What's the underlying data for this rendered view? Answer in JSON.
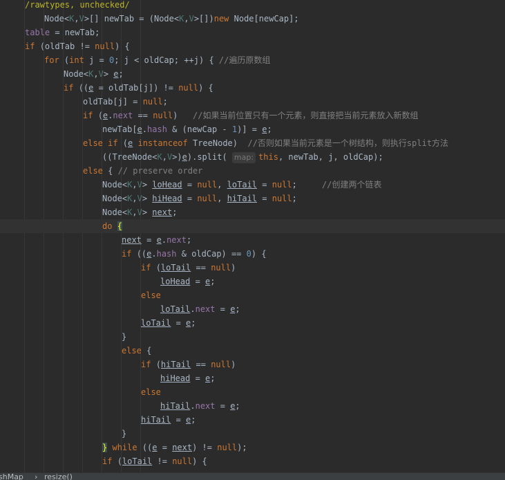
{
  "editor": {
    "lines": [
      [
        [
          "ann",
          "/rawtypes, unchecked/"
        ]
      ],
      [
        [
          "",
          "Node<"
        ],
        [
          "tp",
          "K"
        ],
        [
          "",
          ","
        ],
        [
          "tp",
          "V"
        ],
        [
          "",
          ">[] newTab = (Node<"
        ],
        [
          "tp",
          "K"
        ],
        [
          "",
          ","
        ],
        [
          "tp",
          "V"
        ],
        [
          "",
          ">[])"
        ],
        [
          "kw",
          "new "
        ],
        [
          "",
          "Node[newCap];"
        ]
      ],
      [
        [
          "fld",
          "table"
        ],
        [
          "",
          " = newTab;"
        ]
      ],
      [
        [
          "kw",
          "if "
        ],
        [
          "",
          "(oldTab != "
        ],
        [
          "kw",
          "null"
        ],
        [
          "",
          ") {"
        ]
      ],
      [
        [
          "kw",
          "for "
        ],
        [
          "",
          "("
        ],
        [
          "kw",
          "int "
        ],
        [
          "",
          "j = "
        ],
        [
          "num",
          "0"
        ],
        [
          "",
          "; j < oldCap; ++j) { "
        ],
        [
          "cmt",
          "//遍历原数组"
        ]
      ],
      [
        [
          "",
          "Node<"
        ],
        [
          "tp",
          "K"
        ],
        [
          "",
          ","
        ],
        [
          "tp",
          "V"
        ],
        [
          "",
          "> "
        ],
        [
          "ul",
          "e"
        ],
        [
          "",
          ";"
        ]
      ],
      [
        [
          "kw",
          "if "
        ],
        [
          "",
          "(("
        ],
        [
          "ul",
          "e"
        ],
        [
          "",
          " = oldTab[j]) != "
        ],
        [
          "kw",
          "null"
        ],
        [
          "",
          ") {"
        ]
      ],
      [
        [
          "",
          "oldTab[j] = "
        ],
        [
          "kw",
          "null"
        ],
        [
          "",
          ";"
        ]
      ],
      [
        [
          "kw",
          "if "
        ],
        [
          "",
          "("
        ],
        [
          "ul",
          "e"
        ],
        [
          "",
          "."
        ],
        [
          "fld",
          "next"
        ],
        [
          "",
          " == "
        ],
        [
          "kw",
          "null"
        ],
        [
          "",
          ")   "
        ],
        [
          "cmt",
          "//如果当前位置只有一个元素，则直接把当前元素放入新数组"
        ]
      ],
      [
        [
          "",
          "newTab["
        ],
        [
          "ul",
          "e"
        ],
        [
          "",
          "."
        ],
        [
          "fld",
          "hash"
        ],
        [
          "",
          " & (newCap - "
        ],
        [
          "num",
          "1"
        ],
        [
          "",
          ")] = "
        ],
        [
          "ul",
          "e"
        ],
        [
          "",
          ";"
        ]
      ],
      [
        [
          "kw",
          "else if "
        ],
        [
          "",
          "("
        ],
        [
          "ul",
          "e"
        ],
        [
          "",
          " "
        ],
        [
          "kw",
          "instanceof "
        ],
        [
          "",
          "TreeNode)  "
        ],
        [
          "cmt",
          "//否则如果当前元素是一个树结构，则执行split方法"
        ]
      ],
      [
        [
          "",
          "((TreeNode<"
        ],
        [
          "tp",
          "K"
        ],
        [
          "",
          ","
        ],
        [
          "tp",
          "V"
        ],
        [
          "",
          ">)"
        ],
        [
          "ul",
          "e"
        ],
        [
          "",
          ").split( "
        ],
        [
          "hint",
          "map:"
        ],
        [
          "kw",
          "this"
        ],
        [
          "",
          ", newTab, j, oldCap);"
        ]
      ],
      [
        [
          "kw",
          "else "
        ],
        [
          "",
          "{ "
        ],
        [
          "cmt",
          "// preserve order"
        ]
      ],
      [
        [
          "",
          "Node<"
        ],
        [
          "tp",
          "K"
        ],
        [
          "",
          ","
        ],
        [
          "tp",
          "V"
        ],
        [
          "",
          "> "
        ],
        [
          "ul",
          "loHead"
        ],
        [
          "",
          " = "
        ],
        [
          "kw",
          "null"
        ],
        [
          "",
          ", "
        ],
        [
          "ul",
          "loTail"
        ],
        [
          "",
          " = "
        ],
        [
          "kw",
          "null"
        ],
        [
          "",
          ";     "
        ],
        [
          "cmt",
          "//创建两个链表"
        ]
      ],
      [
        [
          "",
          "Node<"
        ],
        [
          "tp",
          "K"
        ],
        [
          "",
          ","
        ],
        [
          "tp",
          "V"
        ],
        [
          "",
          "> "
        ],
        [
          "ul",
          "hiHead"
        ],
        [
          "",
          " = "
        ],
        [
          "kw",
          "null"
        ],
        [
          "",
          ", "
        ],
        [
          "ul",
          "hiTail"
        ],
        [
          "",
          " = "
        ],
        [
          "kw",
          "null"
        ],
        [
          "",
          ";"
        ]
      ],
      [
        [
          "",
          "Node<"
        ],
        [
          "tp",
          "K"
        ],
        [
          "",
          ","
        ],
        [
          "tp",
          "V"
        ],
        [
          "",
          "> "
        ],
        [
          "ul",
          "next"
        ],
        [
          "",
          ";"
        ]
      ],
      [
        [
          "kw",
          "do "
        ],
        [
          "brace",
          "{"
        ]
      ],
      [
        [
          "ul",
          "next"
        ],
        [
          "",
          " = "
        ],
        [
          "ul",
          "e"
        ],
        [
          "",
          "."
        ],
        [
          "fld",
          "next"
        ],
        [
          "",
          ";"
        ]
      ],
      [
        [
          "kw",
          "if "
        ],
        [
          "",
          "(("
        ],
        [
          "ul",
          "e"
        ],
        [
          "",
          "."
        ],
        [
          "fld",
          "hash"
        ],
        [
          "",
          " & oldCap) == "
        ],
        [
          "num",
          "0"
        ],
        [
          "",
          ") {"
        ]
      ],
      [
        [
          "kw",
          "if "
        ],
        [
          "",
          "("
        ],
        [
          "ul",
          "loTail"
        ],
        [
          "",
          " == "
        ],
        [
          "kw",
          "null"
        ],
        [
          "",
          ")"
        ]
      ],
      [
        [
          "ul",
          "loHead"
        ],
        [
          "",
          " = "
        ],
        [
          "ul",
          "e"
        ],
        [
          "",
          ";"
        ]
      ],
      [
        [
          "kw",
          "else"
        ]
      ],
      [
        [
          "ul",
          "loTail"
        ],
        [
          "",
          "."
        ],
        [
          "fld",
          "next"
        ],
        [
          "",
          " = "
        ],
        [
          "ul",
          "e"
        ],
        [
          "",
          ";"
        ]
      ],
      [
        [
          "ul",
          "loTail"
        ],
        [
          "",
          " = "
        ],
        [
          "ul",
          "e"
        ],
        [
          "",
          ";"
        ]
      ],
      [
        [
          "",
          "}"
        ]
      ],
      [
        [
          "kw",
          "else "
        ],
        [
          "",
          "{"
        ]
      ],
      [
        [
          "kw",
          "if "
        ],
        [
          "",
          "("
        ],
        [
          "ul",
          "hiTail"
        ],
        [
          "",
          " == "
        ],
        [
          "kw",
          "null"
        ],
        [
          "",
          ")"
        ]
      ],
      [
        [
          "ul",
          "hiHead"
        ],
        [
          "",
          " = "
        ],
        [
          "ul",
          "e"
        ],
        [
          "",
          ";"
        ]
      ],
      [
        [
          "kw",
          "else"
        ]
      ],
      [
        [
          "ul",
          "hiTail"
        ],
        [
          "",
          "."
        ],
        [
          "fld",
          "next"
        ],
        [
          "",
          " = "
        ],
        [
          "ul",
          "e"
        ],
        [
          "",
          ";"
        ]
      ],
      [
        [
          "ul",
          "hiTail"
        ],
        [
          "",
          " = "
        ],
        [
          "ul",
          "e"
        ],
        [
          "",
          ";"
        ]
      ],
      [
        [
          "",
          "}"
        ]
      ],
      [
        [
          "brace",
          "}"
        ],
        [
          "",
          " "
        ],
        [
          "kw",
          "while "
        ],
        [
          "",
          "(("
        ],
        [
          "ul",
          "e"
        ],
        [
          "",
          " = "
        ],
        [
          "ul",
          "next"
        ],
        [
          "",
          ") != "
        ],
        [
          "kw",
          "null"
        ],
        [
          "",
          ");"
        ]
      ],
      [
        [
          "kw",
          "if "
        ],
        [
          "",
          "("
        ],
        [
          "ul",
          "loTail"
        ],
        [
          "",
          " != "
        ],
        [
          "kw",
          "null"
        ],
        [
          "",
          ") {"
        ]
      ]
    ],
    "current_line": 16
  },
  "breadcrumb": {
    "items": [
      "shMap",
      "resize()"
    ],
    "separator": "›"
  },
  "colors": {
    "background": "#2b2b2b",
    "text": "#a9b7c6",
    "keyword": "#cc7832",
    "type_param": "#507874",
    "number": "#6897bb",
    "field": "#9876aa",
    "comment": "#808080",
    "annotation": "#bbb529"
  }
}
